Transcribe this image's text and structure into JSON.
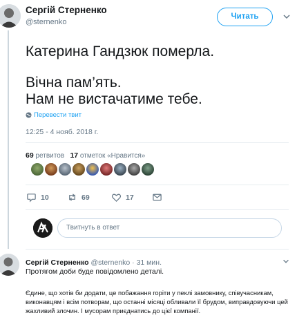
{
  "tweet": {
    "author_name": "Сергій Стерненко",
    "author_handle": "@sternenko",
    "follow_label": "Читать",
    "lines": [
      "Катерина Гандзюк померла.",
      "Вічна пам’ять.",
      "Нам не вистачатиме тебе."
    ],
    "translate_label": "Перевести твит",
    "timestamp": "12:25 - 4 нояб. 2018 г.",
    "retweets_count": "69",
    "retweets_label": "ретвитов",
    "likes_count": "17",
    "likes_label": "отметок «Нравится»",
    "actions": {
      "replies": "10",
      "retweets": "69",
      "likes": "17"
    }
  },
  "reply_composer": {
    "placeholder": "Твитнуть в ответ"
  },
  "reply": {
    "author_name": "Сергій Стерненко",
    "author_handle": "@sternenko",
    "time": "· 31 мин.",
    "line1": "Протягом доби буде повідомлено деталі.",
    "paragraph": "Єдине, що хотів би додати, це побажання горіти у пеклі замовнику, співучасникам, виконавцям і всім потворам, що останні місяці обливали її брудом, виправдовуючи цей жахливий злочин. І мусорам приєднатись до цієї компанії."
  },
  "colors": {
    "accent": "#1da1f2",
    "muted": "#657786",
    "text": "#14171a",
    "divider": "#e6ecf0"
  },
  "icons": [
    "chevron-down-icon",
    "globe-icon",
    "reply-icon",
    "retweet-icon",
    "heart-icon",
    "envelope-icon"
  ]
}
